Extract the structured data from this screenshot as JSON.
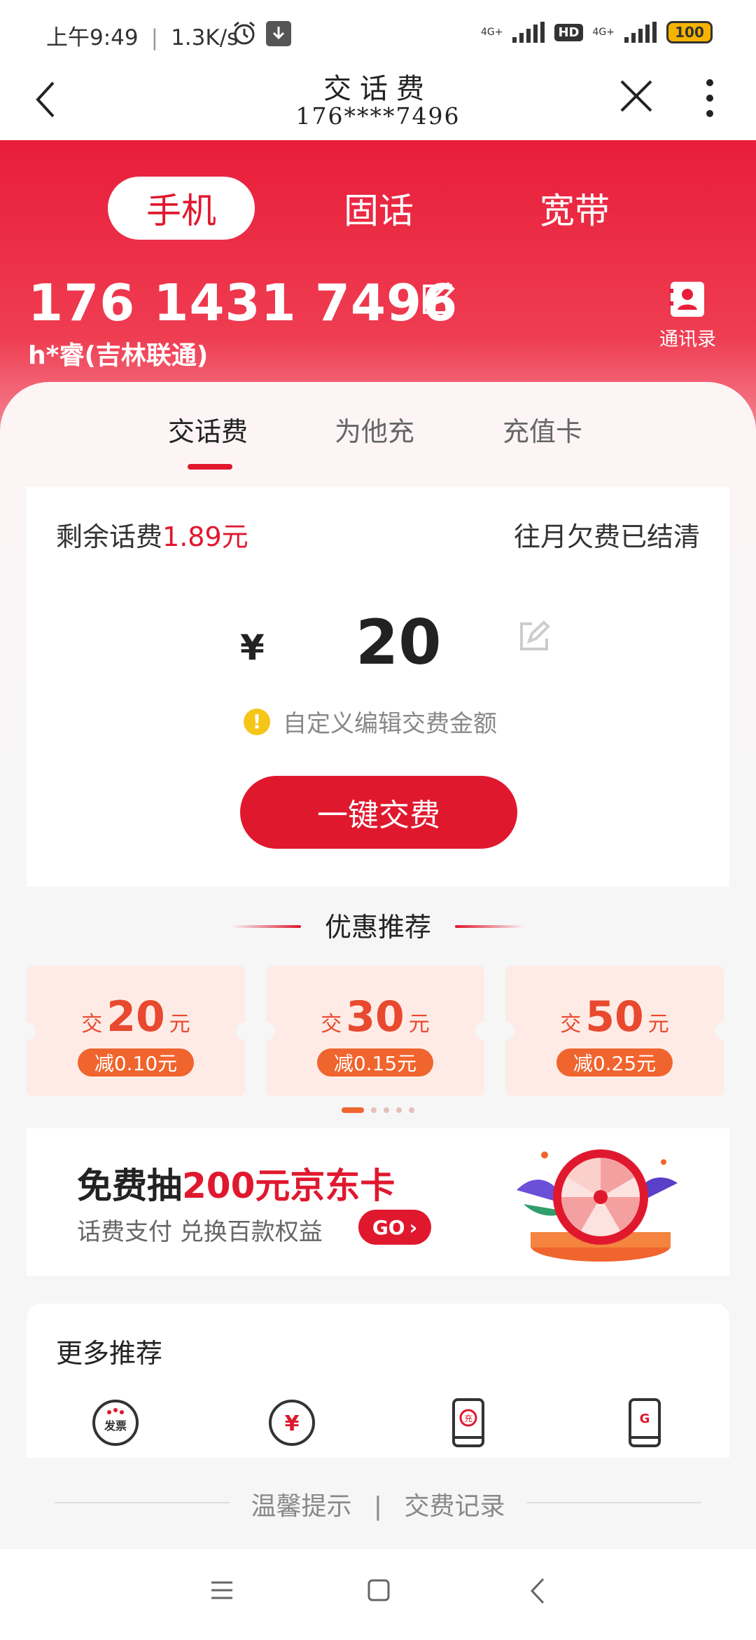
{
  "status": {
    "time": "上午9:49",
    "speed": "1.3K/s",
    "net1": "4G+",
    "net2": "4G+",
    "hd": "HD",
    "battery": "100"
  },
  "nav": {
    "title": "交话费",
    "subtitle": "176****7496"
  },
  "tabs": {
    "mobile": "手机",
    "landline": "固话",
    "broadband": "宽带"
  },
  "account": {
    "number": "176 1431 7496",
    "owner": "h*睿(吉林联通)",
    "contacts_label": "通讯录"
  },
  "subtabs": {
    "recharge": "交话费",
    "for_others": "为他充",
    "card": "充值卡"
  },
  "balance": {
    "label": "剩余话费",
    "value": "1.89元",
    "arrears": "往月欠费已结清"
  },
  "amount": {
    "currency": "¥",
    "value": "20",
    "tip": "自定义编辑交费金额",
    "pay_button": "一键交费"
  },
  "offers": {
    "title": "优惠推荐",
    "items": [
      {
        "prefix": "交",
        "amount": "20",
        "unit": "元",
        "discount": "减0.10元"
      },
      {
        "prefix": "交",
        "amount": "30",
        "unit": "元",
        "discount": "减0.15元"
      },
      {
        "prefix": "交",
        "amount": "50",
        "unit": "元",
        "discount": "减0.25元"
      }
    ]
  },
  "banner": {
    "title_prefix": "免费抽",
    "title_highlight": "200元京东卡",
    "subtitle": "话费支付 兑换百款权益",
    "go": "GO"
  },
  "more": {
    "title": "更多推荐",
    "icon1_text": "发票",
    "icon2_text": "¥",
    "icon3_text": "充",
    "icon4_text": "G"
  },
  "footer": {
    "tips": "温馨提示",
    "sep": "|",
    "records": "交费记录"
  },
  "colors": {
    "brand": "#e0182e",
    "coupon_text": "#e8492f",
    "coupon_bg": "#feebe5"
  }
}
